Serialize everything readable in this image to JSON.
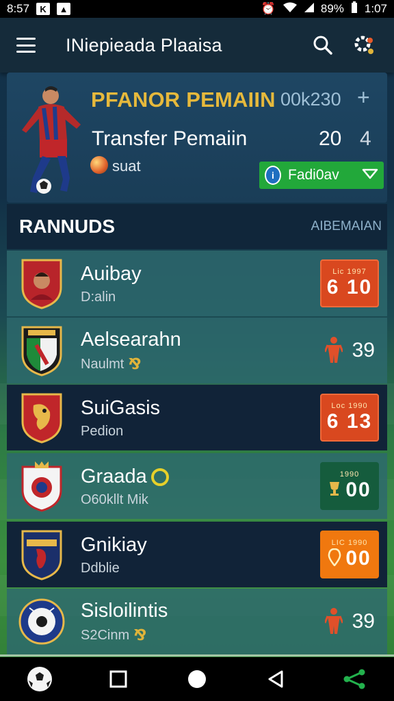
{
  "status_bar": {
    "time_left": "8:57",
    "battery": "89%",
    "time_right": "1:07"
  },
  "app_bar": {
    "title": "INiepieada Plaaisa"
  },
  "hero": {
    "heading": "PFANOR PEMAIIN",
    "code": "00k230",
    "plus": "+",
    "subtitle": "Transfer Pemaiin",
    "number_a": "20",
    "number_b": "4",
    "status": "suat",
    "select_label": "Fadi0av"
  },
  "section": {
    "title": "RANNUDS",
    "link": "AIBEMAIAN"
  },
  "rows": [
    {
      "name": "Auibay",
      "sub": "D:alin",
      "score_top": "Lic  1997",
      "score": "6 10",
      "style": "red"
    },
    {
      "name": "Aelsearahn",
      "sub": "Naulmt",
      "score": "39",
      "style": "plain"
    },
    {
      "name": "SuiGasis",
      "sub": "Pedion",
      "score_top": "Loc  1990",
      "score": "6 13",
      "style": "red"
    },
    {
      "name": "Graada",
      "sub": "O60kllt Mik",
      "score_top": "1990",
      "score": "00",
      "style": "green"
    },
    {
      "name": "Gnikiay",
      "sub": "Ddblie",
      "score_top": "LIC  1990",
      "score": "00",
      "style": "orange"
    },
    {
      "name": "Sisloilintis",
      "sub": "S2Cinm",
      "score": "39",
      "style": "plain"
    }
  ],
  "colors": {
    "accent_gold": "#e6b93c",
    "accent_green": "#22a83a",
    "accent_red": "#d9481f",
    "accent_orange": "#f0780f"
  }
}
